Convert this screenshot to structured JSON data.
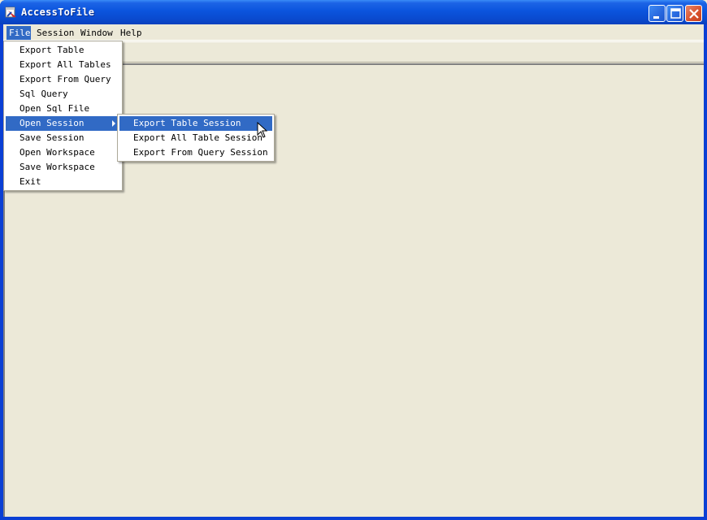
{
  "window": {
    "title": "AccessToFile",
    "controls": {
      "minimize": "minimize-icon",
      "maximize": "maximize-icon",
      "close": "close-icon"
    }
  },
  "menubar": {
    "items": [
      {
        "label": "File",
        "active": true
      },
      {
        "label": "Session",
        "active": false
      },
      {
        "label": "Window",
        "active": false
      },
      {
        "label": "Help",
        "active": false
      }
    ]
  },
  "file_menu": {
    "items": [
      {
        "label": "Export Table"
      },
      {
        "label": "Export All Tables"
      },
      {
        "label": "Export From Query"
      },
      {
        "label": "Sql Query"
      },
      {
        "label": "Open Sql File"
      },
      {
        "label": "Open Session",
        "has_submenu": true,
        "active": true
      },
      {
        "label": "Save Session"
      },
      {
        "label": "Open Workspace"
      },
      {
        "label": "Save Workspace"
      },
      {
        "label": "Exit"
      }
    ]
  },
  "open_session_submenu": {
    "items": [
      {
        "label": "Export Table Session",
        "active": true
      },
      {
        "label": "Export All Table Session"
      },
      {
        "label": "Export From Query Session"
      }
    ]
  },
  "colors": {
    "title_bar": "#0a4bd0",
    "highlight": "#316ac5",
    "face": "#ece9d8",
    "close_button": "#d8502c"
  }
}
